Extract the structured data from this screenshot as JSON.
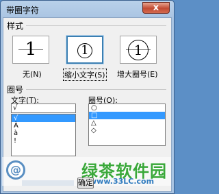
{
  "window": {
    "title": "带圈字符",
    "close_glyph": "x"
  },
  "style_section": {
    "label": "样式",
    "options": [
      {
        "label_prefix": "无",
        "hotkey": "N",
        "label": "无(N)",
        "glyph": "1",
        "selected": false
      },
      {
        "label_prefix": "缩小文字",
        "hotkey": "S",
        "label": "缩小文字(S)",
        "glyph": "1",
        "selected": true
      },
      {
        "label_prefix": "增大圈号",
        "hotkey": "E",
        "label": "增大圈号(E)",
        "glyph": "1",
        "selected": false
      }
    ]
  },
  "mark_section": {
    "label": "圈号",
    "text_label": "文字(T):",
    "text_value": "√",
    "text_items": [
      "√",
      "À",
      "à",
      "!"
    ],
    "text_selected_index": 0,
    "enclosure_label": "圈号(O):",
    "enclosure_items": [
      "○",
      "□",
      "△",
      "◇"
    ],
    "enclosure_selected_index": 1
  },
  "buttons": {
    "ok": "确定"
  },
  "watermark": {
    "brand": "绿茶软件园",
    "url": "www.33LC.com",
    "logo_glyph": "@"
  },
  "colors": {
    "selection": "#3399ff",
    "title_bar": "#b9d1ea",
    "close": "#c24a32",
    "watermark_green": "#3aa83a"
  }
}
